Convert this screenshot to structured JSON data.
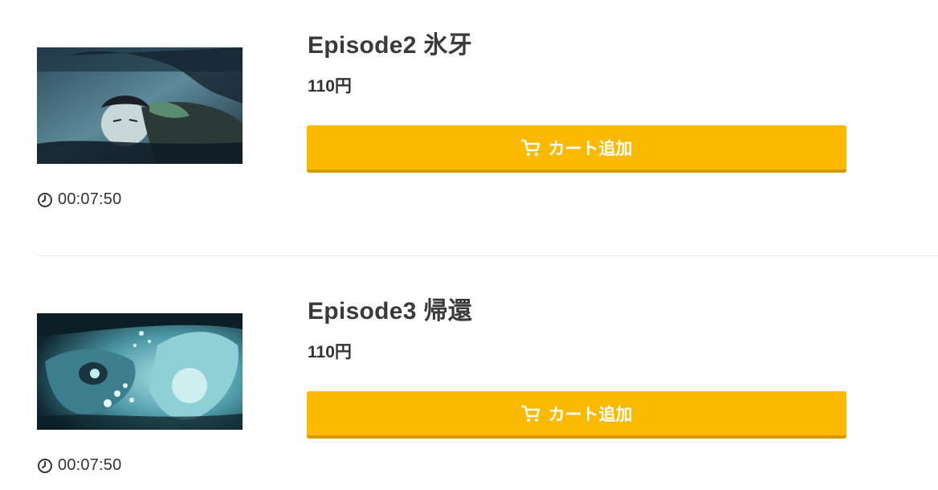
{
  "episodes": [
    {
      "title": "Episode2 氷牙",
      "price": "110円",
      "duration": "00:07:50",
      "button_label": "カート追加",
      "thumbnail_icon": "episode-thumbnail-image"
    },
    {
      "title": "Episode3 帰還",
      "price": "110円",
      "duration": "00:07:50",
      "button_label": "カート追加",
      "thumbnail_icon": "episode-thumbnail-image"
    }
  ],
  "colors": {
    "button": "#fbb900",
    "button_shadow": "#d49a00",
    "text": "#333333",
    "divider": "#e8e8e8"
  },
  "icons": {
    "cart": "cart-icon",
    "clock": "clock-icon"
  }
}
